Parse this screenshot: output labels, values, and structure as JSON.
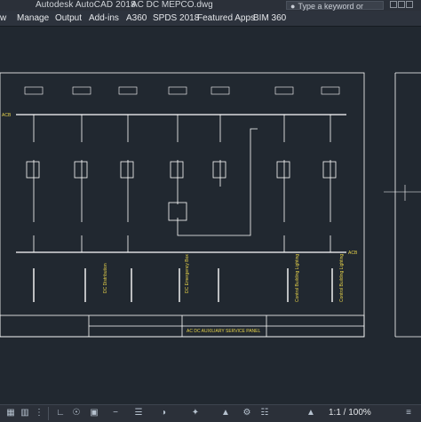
{
  "title": {
    "app": "Autodesk AutoCAD 2018",
    "file": "AC DC MEPCO.dwg",
    "search_placeholder": "Type a keyword or phrase"
  },
  "ribbon": {
    "tabs": [
      "w",
      "Manage",
      "Output",
      "Add-ins",
      "A360",
      "SPDS 2018",
      "Featured Apps",
      "BIM 360"
    ]
  },
  "drawing": {
    "bus_label_left": "ACB",
    "bus_label_right": "ACB",
    "feeder_labels": [
      "DC Distribution",
      "DC Emergency Box",
      "Control Building Lighting",
      "Control Building Lighting"
    ],
    "title_block": "AC DC AUXILIARY SERVICE PANEL"
  },
  "status": {
    "zoom": "1:1 / 100%",
    "icons": [
      "model-icon",
      "grid-icon",
      "snap-icon",
      "ortho-icon",
      "polar-icon",
      "osnap-icon",
      "otrack-icon",
      "lineweight-icon",
      "transparency-icon",
      "selection-icon",
      "annotation-icon",
      "workspace-icon",
      "settings-icon"
    ]
  },
  "colors": {
    "background": "#212830",
    "line": "#ffffff",
    "text_yellow": "#e6d24a",
    "text_red": "#e06060"
  }
}
